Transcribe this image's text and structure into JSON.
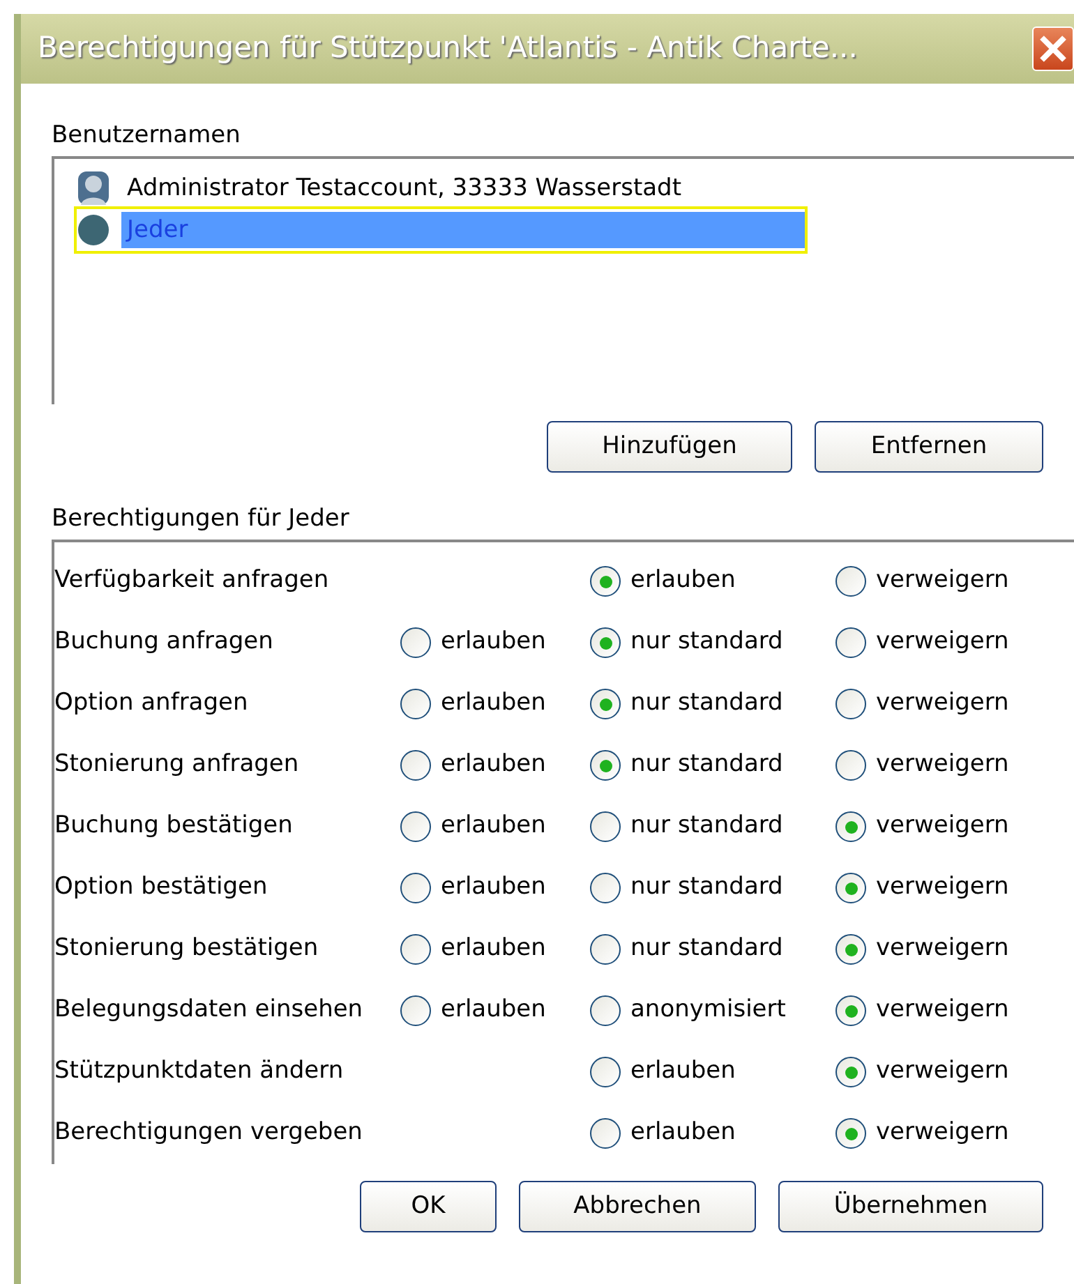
{
  "window": {
    "title": "Berechtigungen für Stützpunkt 'Atlantis - Antik Charte..."
  },
  "users": {
    "label": "Benutzernamen",
    "items": [
      {
        "name": "Administrator Testaccount, 33333 Wasserstadt",
        "kind": "person",
        "selected": false
      },
      {
        "name": "Jeder",
        "kind": "group",
        "selected": true
      }
    ]
  },
  "user_buttons": [
    "Hinzufügen",
    "Entfernen"
  ],
  "permissions": {
    "label": "Berechtigungen für Jeder",
    "rows": [
      {
        "label": "Verfügbarkeit anfragen",
        "kind": "binary",
        "options": [
          {
            "label": "erlauben",
            "selected": true
          },
          {
            "label": "verweigern",
            "selected": false
          }
        ]
      },
      {
        "label": "Buchung anfragen",
        "options": [
          {
            "label": "erlauben",
            "selected": false
          },
          {
            "label": "nur standard",
            "selected": true
          },
          {
            "label": "verweigern",
            "selected": false
          }
        ]
      },
      {
        "label": "Option anfragen",
        "options": [
          {
            "label": "erlauben",
            "selected": false
          },
          {
            "label": "nur standard",
            "selected": true
          },
          {
            "label": "verweigern",
            "selected": false
          }
        ]
      },
      {
        "label": "Stonierung anfragen",
        "options": [
          {
            "label": "erlauben",
            "selected": false
          },
          {
            "label": "nur standard",
            "selected": true
          },
          {
            "label": "verweigern",
            "selected": false
          }
        ]
      },
      {
        "label": "Buchung bestätigen",
        "options": [
          {
            "label": "erlauben",
            "selected": false
          },
          {
            "label": "nur standard",
            "selected": false
          },
          {
            "label": "verweigern",
            "selected": true
          }
        ]
      },
      {
        "label": "Option bestätigen",
        "options": [
          {
            "label": "erlauben",
            "selected": false
          },
          {
            "label": "nur standard",
            "selected": false
          },
          {
            "label": "verweigern",
            "selected": true
          }
        ]
      },
      {
        "label": "Stonierung bestätigen",
        "options": [
          {
            "label": "erlauben",
            "selected": false
          },
          {
            "label": "nur standard",
            "selected": false
          },
          {
            "label": "verweigern",
            "selected": true
          }
        ]
      },
      {
        "label": "Belegungsdaten einsehen",
        "options": [
          {
            "label": "erlauben",
            "selected": false
          },
          {
            "label": "anonymisiert",
            "selected": false
          },
          {
            "label": "verweigern",
            "selected": true
          }
        ]
      },
      {
        "label": "Stützpunktdaten ändern",
        "kind": "binary",
        "options": [
          {
            "label": "erlauben",
            "selected": false
          },
          {
            "label": "verweigern",
            "selected": true
          }
        ]
      },
      {
        "label": "Berechtigungen vergeben",
        "kind": "binary",
        "options": [
          {
            "label": "erlauben",
            "selected": false
          },
          {
            "label": "verweigern",
            "selected": true
          }
        ]
      }
    ]
  },
  "buttons": [
    "OK",
    "Abbrechen",
    "Übernehmen"
  ]
}
